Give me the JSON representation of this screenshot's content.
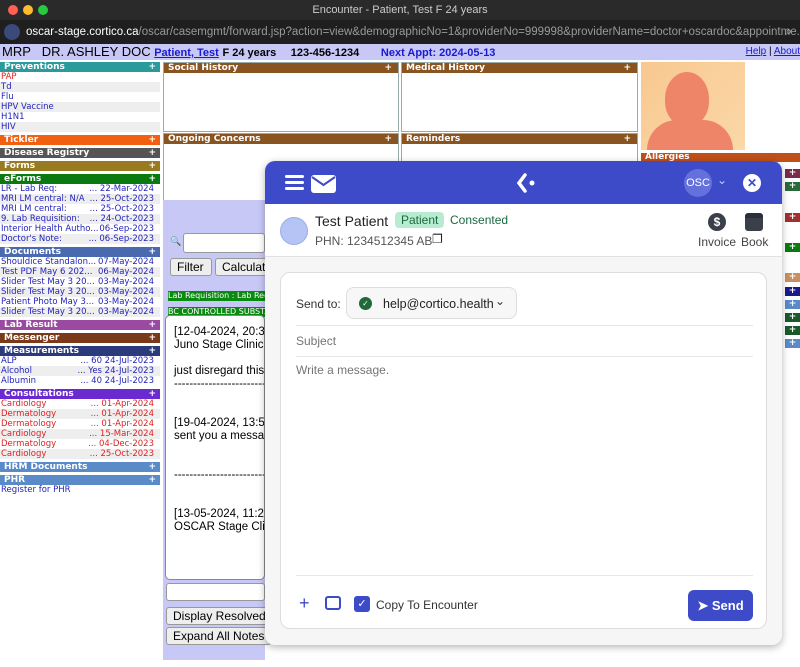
{
  "window": {
    "title": "Encounter - Patient, Test F 24 years"
  },
  "address": {
    "host": "oscar-stage.cortico.ca",
    "path": "/oscar/casemgmt/forward.jsp?action=view&demographicNo=1&providerNo=999998&providerName=doctor+oscardoc&appointme..."
  },
  "header": {
    "mrp_label": "MRP",
    "doctor": "DR. ASHLEY DOC",
    "patient_link": "Patient, Test",
    "sex_age": "F 24 years",
    "phone": "123-456-1234",
    "next_appt": "Next Appt: 2024-05-13",
    "help": "Help",
    "about": "About"
  },
  "sidebar": [
    {
      "title": "Preventions",
      "color": "#2a9a9a",
      "items": [
        {
          "l": "PAP",
          "red": true
        },
        {
          "l": "Td"
        },
        {
          "l": "Flu"
        },
        {
          "l": "HPV Vaccine"
        },
        {
          "l": "H1N1"
        },
        {
          "l": "HIV"
        }
      ]
    },
    {
      "title": "Tickler",
      "color": "#f06010",
      "items": []
    },
    {
      "title": "Disease Registry",
      "color": "#555555",
      "items": []
    },
    {
      "title": "Forms",
      "color": "#9a7a20",
      "items": []
    },
    {
      "title": "eForms",
      "color": "#0a7a10",
      "items": [
        {
          "l": "LR - Lab Req:",
          "d": "... 22-Mar-2024"
        },
        {
          "l": "MRI LM central: N/A",
          "d": "... 25-Oct-2023"
        },
        {
          "l": "MRI LM central:",
          "d": "... 25-Oct-2023"
        },
        {
          "l": "9. Lab Requisition:",
          "d": "... 24-Oct-2023"
        },
        {
          "l": "Interior Health Autho...",
          "d": "06-Sep-2023"
        },
        {
          "l": "Doctor's Note:",
          "d": "... 06-Sep-2023"
        }
      ]
    },
    {
      "title": "Documents",
      "color": "#4a6ab0",
      "items": [
        {
          "l": "Shouldice Standalon...",
          "d": "07-May-2024"
        },
        {
          "l": "Test PDF May 6 202...",
          "d": "06-May-2024"
        },
        {
          "l": "Slider Test May 3 20...",
          "d": "03-May-2024"
        },
        {
          "l": "Slider Test May 3 20...",
          "d": "03-May-2024"
        },
        {
          "l": "Patient Photo May 3...",
          "d": "03-May-2024"
        },
        {
          "l": "Slider Test May 3 20...",
          "d": "03-May-2024"
        }
      ]
    },
    {
      "title": "Lab Result",
      "color": "#9a4aa0",
      "items": []
    },
    {
      "title": "Messenger",
      "color": "#7a3a1a",
      "items": []
    },
    {
      "title": "Measurements",
      "color": "#2a3a7a",
      "items": [
        {
          "l": "ALP",
          "d": "... 60 24-Jul-2023"
        },
        {
          "l": "Alcohol",
          "d": "... Yes 24-Jul-2023"
        },
        {
          "l": "Albumin",
          "d": "... 40 24-Jul-2023"
        }
      ]
    },
    {
      "title": "Consultations",
      "color": "#6a2ad0",
      "items": [
        {
          "l": "Cardiology",
          "d": "... 01-Apr-2024",
          "red": true
        },
        {
          "l": "Dermatology",
          "d": "... 01-Apr-2024",
          "red": true
        },
        {
          "l": "Dermatology",
          "d": "... 01-Apr-2024",
          "red": true
        },
        {
          "l": "Cardiology",
          "d": "... 15-Mar-2024",
          "red": true
        },
        {
          "l": "Dermatology",
          "d": "... 04-Dec-2023",
          "red": true
        },
        {
          "l": "Cardiology",
          "d": "... 25-Oct-2023",
          "red": true
        }
      ]
    },
    {
      "title": "HRM Documents",
      "color": "#5a8ac8",
      "items": []
    },
    {
      "title": "PHR",
      "color": "#5a8ac8",
      "items": [
        {
          "l": "Register for PHR"
        }
      ]
    }
  ],
  "panels": {
    "social": "Social History",
    "medical": "Medical History",
    "ongoing": "Ongoing Concerns",
    "reminders": "Reminders",
    "allergies": "Allergies",
    "plus": "+"
  },
  "middle": {
    "filter": "Filter",
    "calculate": "Calculators",
    "lab_req": "Lab Requisition : Lab Req",
    "bc": "BC CONTROLLED SUBSTANCE",
    "display_resolved": "Display Resolved Issues",
    "expand_notes": "Expand All Notes"
  },
  "notes": [
    "[12-04-2024, 20:3",
    "Juno Stage Clinic",
    "",
    "just disregard this",
    "----------------------------",
    "",
    "",
    "[19-04-2024, 13:5",
    "sent you a messa",
    "",
    "",
    "----------------------------",
    "",
    "",
    "[13-05-2024, 11:2",
    "OSCAR Stage Cli"
  ],
  "modal": {
    "avatar": "OSC",
    "patient_name": "Test Patient",
    "badge": "Patient",
    "consent": "Consented",
    "phn": "PHN: 1234512345 AB",
    "invoice": "Invoice",
    "book": "Book",
    "send_to_label": "Send to:",
    "recipient": "help@cortico.health",
    "subject_placeholder": "Subject",
    "message_placeholder": "Write a message.",
    "copy_label": "Copy To Encounter",
    "copy_checked": true,
    "send": "Send",
    "accent": "#3d4bc9"
  }
}
